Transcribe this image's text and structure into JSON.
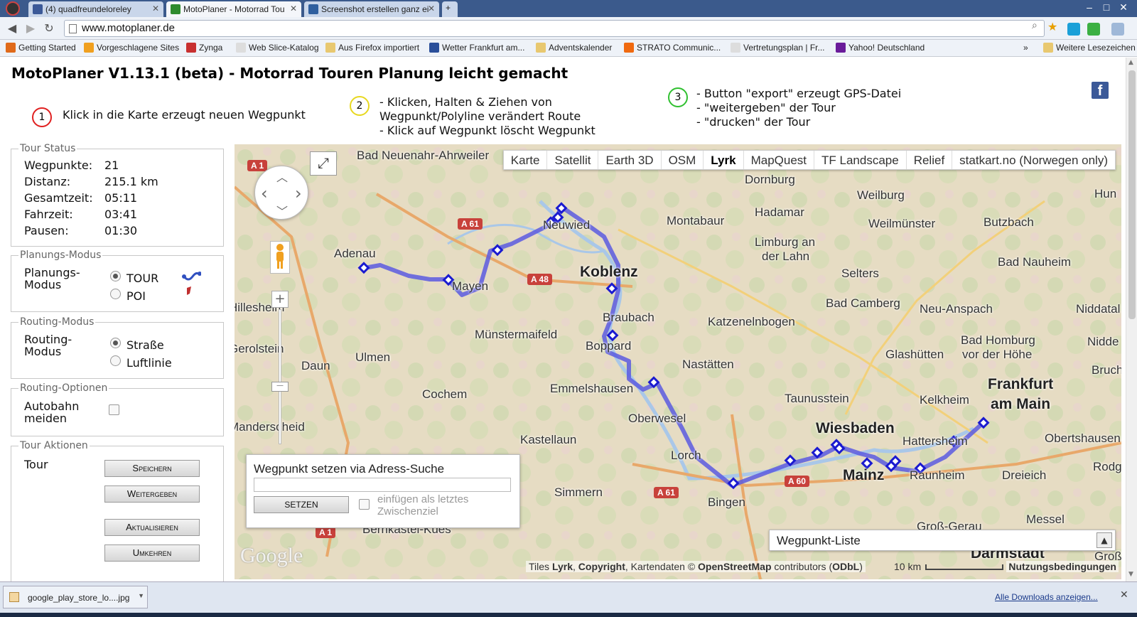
{
  "browser": {
    "tabs": [
      {
        "label": "(4) quadfreundeloreley",
        "color": "#3b5998"
      },
      {
        "label": "MotoPlaner - Motorrad Tou",
        "color": "#2e8b2e"
      },
      {
        "label": "Screenshot erstellen ganz ei",
        "color": "#2f5f9f"
      }
    ],
    "url": "www.motoplaner.de",
    "window_controls": {
      "minimize": "–",
      "maximize": "□",
      "close": "✕"
    },
    "bookmarks": [
      {
        "label": "Getting Started",
        "color": "#e06a1a"
      },
      {
        "label": "Vorgeschlagene Sites",
        "color": "#f0a020"
      },
      {
        "label": "Zynga",
        "color": "#c83030"
      },
      {
        "label": "Web Slice-Katalog",
        "color": "#dddddd"
      },
      {
        "label": "Aus Firefox importiert",
        "color": "#e8c870"
      },
      {
        "label": "Wetter Frankfurt am...",
        "color": "#2a4f9a"
      },
      {
        "label": "Adventskalender",
        "color": "#e8c870"
      },
      {
        "label": "STRATO Communic...",
        "color": "#f06a10"
      },
      {
        "label": "Vertretungsplan | Fr...",
        "color": "#dddddd"
      },
      {
        "label": "Yahoo! Deutschland",
        "color": "#6a1b9a"
      }
    ],
    "bookmarks_more": "»",
    "other_bookmarks": "Weitere Lesezeichen"
  },
  "page": {
    "title": "MotoPlaner V1.13.1 (beta) - Motorrad Touren Planung leicht gemacht",
    "steps": [
      {
        "num": "1",
        "color": "#e02020",
        "lines": [
          "Klick in die Karte erzeugt neuen Wegpunkt"
        ]
      },
      {
        "num": "2",
        "color": "#e8d820",
        "lines": [
          "- Klicken, Halten & Ziehen von",
          "Wegpunkt/Polyline verändert Route",
          "- Klick auf Wegpunkt löscht Wegpunkt"
        ]
      },
      {
        "num": "3",
        "color": "#30c030",
        "lines": [
          "- Button \"export\" erzeugt GPS-Datei",
          "- \"weitergeben\" der Tour",
          "- \"drucken\" der Tour"
        ]
      }
    ],
    "facebook_icon": "f"
  },
  "tour_status": {
    "legend": "Tour Status",
    "rows": [
      {
        "label": "Wegpunkte:",
        "value": "21"
      },
      {
        "label": "Distanz:",
        "value": "215.1 km"
      },
      {
        "label": "Gesamtzeit:",
        "value": "05:11"
      },
      {
        "label": "Fahrzeit:",
        "value": "03:41"
      },
      {
        "label": "Pausen:",
        "value": "01:30"
      }
    ]
  },
  "planning_mode": {
    "legend": "Planungs-Modus",
    "label_1": "Planungs-",
    "label_2": "Modus",
    "options": [
      {
        "label": "TOUR",
        "selected": true
      },
      {
        "label": "POI",
        "selected": false
      }
    ]
  },
  "routing_mode": {
    "legend": "Routing-Modus",
    "label_1": "Routing-",
    "label_2": "Modus",
    "options": [
      {
        "label": "Straße",
        "selected": true
      },
      {
        "label": "Luftlinie",
        "selected": false
      }
    ]
  },
  "routing_options": {
    "legend": "Routing-Optionen",
    "label_1": "Autobahn",
    "label_2": "meiden",
    "checked": false
  },
  "tour_actions": {
    "legend": "Tour Aktionen",
    "label": "Tour",
    "buttons": [
      "Speichern",
      "Weitergeben",
      "Aktualisieren",
      "Umkehren"
    ]
  },
  "map": {
    "types": [
      "Karte",
      "Satellit",
      "Earth 3D",
      "OSM",
      "Lyrk",
      "MapQuest",
      "TF Landscape",
      "Relief",
      "statkart.no (Norwegen only)"
    ],
    "active_type": "Lyrk",
    "fullscreen_icon": "⤢",
    "pan_arrows": {
      "up": "︿",
      "down": "﹀",
      "left": "‹",
      "right": "›"
    },
    "zoom_in": "+",
    "zoom_knob": "—",
    "labels": [
      {
        "text": "Bad Neuenahr-Ahrweiler",
        "big": false
      },
      {
        "text": "Adenau",
        "big": false
      },
      {
        "text": "Mayen",
        "big": false
      },
      {
        "text": "Neuwied",
        "big": false
      },
      {
        "text": "Koblenz",
        "big": true
      },
      {
        "text": "Montabaur",
        "big": false
      },
      {
        "text": "Hadamar",
        "big": false
      },
      {
        "text": "Weilburg",
        "big": false
      },
      {
        "text": "Weilmünster",
        "big": false
      },
      {
        "text": "Butzbach",
        "big": false
      },
      {
        "text": "Dornburg",
        "big": false
      },
      {
        "text": "Limburg an",
        "big": false
      },
      {
        "text": "der Lahn",
        "big": false
      },
      {
        "text": "Bad Nauheim",
        "big": false
      },
      {
        "text": "Selters",
        "big": false
      },
      {
        "text": "Bad Camberg",
        "big": false
      },
      {
        "text": "Neu-Anspach",
        "big": false
      },
      {
        "text": "Braubach",
        "big": false
      },
      {
        "text": "Katzenelnbogen",
        "big": false
      },
      {
        "text": "Boppard",
        "big": false
      },
      {
        "text": "Münstermaifeld",
        "big": false
      },
      {
        "text": "Hillesheim",
        "big": false
      },
      {
        "text": "Gerolstein",
        "big": false
      },
      {
        "text": "Ulmen",
        "big": false
      },
      {
        "text": "Daun",
        "big": false
      },
      {
        "text": "Nastätten",
        "big": false
      },
      {
        "text": "Glashütten",
        "big": false
      },
      {
        "text": "Bad Homburg",
        "big": false
      },
      {
        "text": "vor der Höhe",
        "big": false
      },
      {
        "text": "Emmelshausen",
        "big": false
      },
      {
        "text": "Cochem",
        "big": false
      },
      {
        "text": "Taunusstein",
        "big": false
      },
      {
        "text": "Kelkheim",
        "big": false
      },
      {
        "text": "Frankfurt",
        "big": true
      },
      {
        "text": "am Main",
        "big": true
      },
      {
        "text": "Oberwesel",
        "big": false
      },
      {
        "text": "Manderscheid",
        "big": false
      },
      {
        "text": "Kastellaun",
        "big": false
      },
      {
        "text": "Wiesbaden",
        "big": true
      },
      {
        "text": "Hattersheim",
        "big": false
      },
      {
        "text": "Obertshausen",
        "big": false
      },
      {
        "text": "Lorch",
        "big": false
      },
      {
        "text": "Mainz",
        "big": true
      },
      {
        "text": "Raunheim",
        "big": false
      },
      {
        "text": "Dreieich",
        "big": false
      },
      {
        "text": "Simmern",
        "big": false
      },
      {
        "text": "Bingen",
        "big": false
      },
      {
        "text": "Groß-Gerau",
        "big": false
      },
      {
        "text": "Messel",
        "big": false
      },
      {
        "text": "Darmstadt",
        "big": true
      },
      {
        "text": "Bernkastel-Kues",
        "big": false
      },
      {
        "text": "Niddatal",
        "big": false
      },
      {
        "text": "Nidde",
        "big": false
      },
      {
        "text": "Bruch",
        "big": false
      },
      {
        "text": "Hun",
        "big": false
      },
      {
        "text": "Rodg",
        "big": false
      },
      {
        "text": "Groß",
        "big": false
      }
    ],
    "road_shields": [
      "A 1",
      "A 61",
      "A 48",
      "A 61",
      "A 60",
      "A 1"
    ],
    "address_search": {
      "title": "Wegpunkt setzen via Adress-Suche",
      "input_value": "",
      "button": "SETZEN",
      "option_line1": "einfügen als letztes",
      "option_line2": "Zwischenziel"
    },
    "waypoint_list": {
      "title": "Wegpunkt-Liste",
      "toggle": "▲"
    },
    "google_logo": "Google",
    "attribution": {
      "prefix": "Tiles ",
      "lyrk": "Lyrk",
      "sep": ", ",
      "copyright": "Copyright",
      "mid": ", Kartendaten © ",
      "osm": "OpenStreetMap",
      "contrib": " contributors (",
      "odbl": "ODbL",
      "end": ")"
    },
    "scale": "10 km",
    "terms": "Nutzungsbedingungen",
    "route_color": "#5a5ae0"
  },
  "downloads": {
    "file": "google_play_store_lo....jpg",
    "show_all": "Alle Downloads anzeigen...",
    "close": "✕"
  }
}
